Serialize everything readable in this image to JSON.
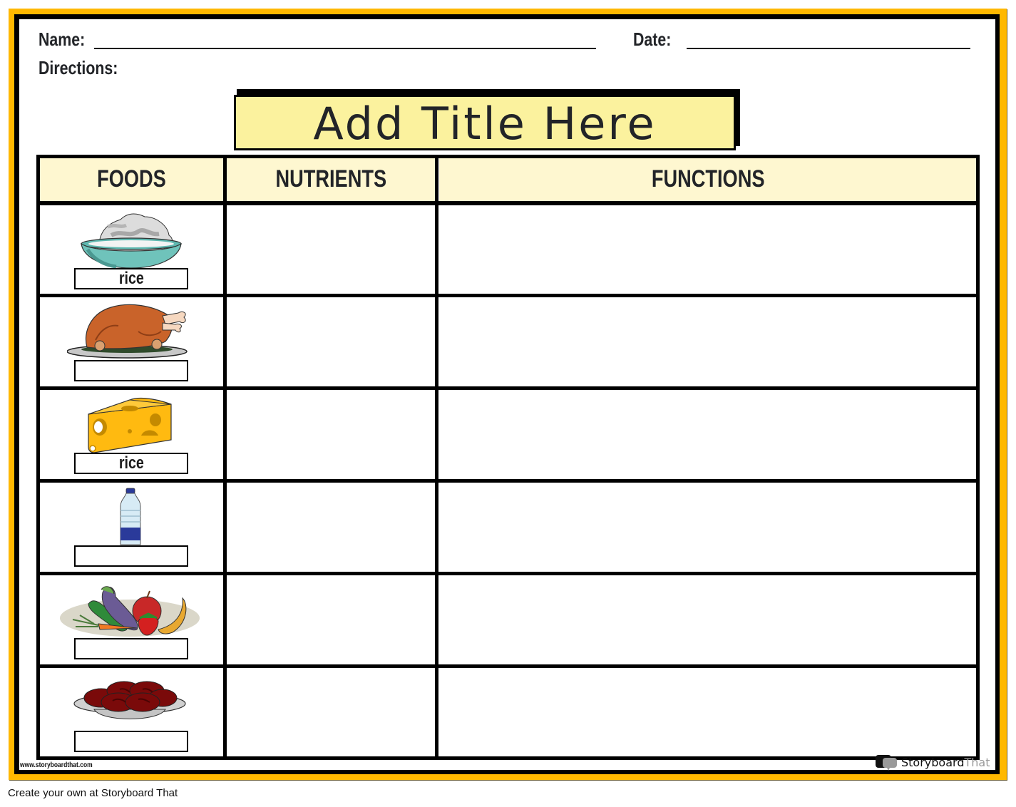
{
  "worksheet": {
    "name_label": "Name:",
    "date_label": "Date:",
    "directions_label": "Directions:",
    "title": "Add Title Here"
  },
  "table": {
    "columns": [
      "FOODS",
      "NUTRIENTS",
      "FUNCTIONS"
    ],
    "rows": [
      {
        "food_icon": "rice-bowl-icon",
        "food_label": "rice",
        "nutrients": "",
        "functions": ""
      },
      {
        "food_icon": "roast-chicken-icon",
        "food_label": "",
        "nutrients": "",
        "functions": ""
      },
      {
        "food_icon": "cheese-icon",
        "food_label": "rice",
        "nutrients": "",
        "functions": ""
      },
      {
        "food_icon": "water-bottle-icon",
        "food_label": "",
        "nutrients": "",
        "functions": ""
      },
      {
        "food_icon": "fruits-vegetables-icon",
        "food_label": "",
        "nutrients": "",
        "functions": ""
      },
      {
        "food_icon": "meat-plate-icon",
        "food_label": "",
        "nutrients": "",
        "functions": ""
      }
    ]
  },
  "branding": {
    "url_watermark": "www.storyboardthat.com",
    "logo_text_dark": "Storyboard",
    "logo_text_light": "That",
    "footer_text": "Create your own at Storyboard That"
  },
  "colors": {
    "frame": "#FFB800",
    "title_fill": "#FBF29E",
    "header_fill": "#FEF7D0"
  }
}
